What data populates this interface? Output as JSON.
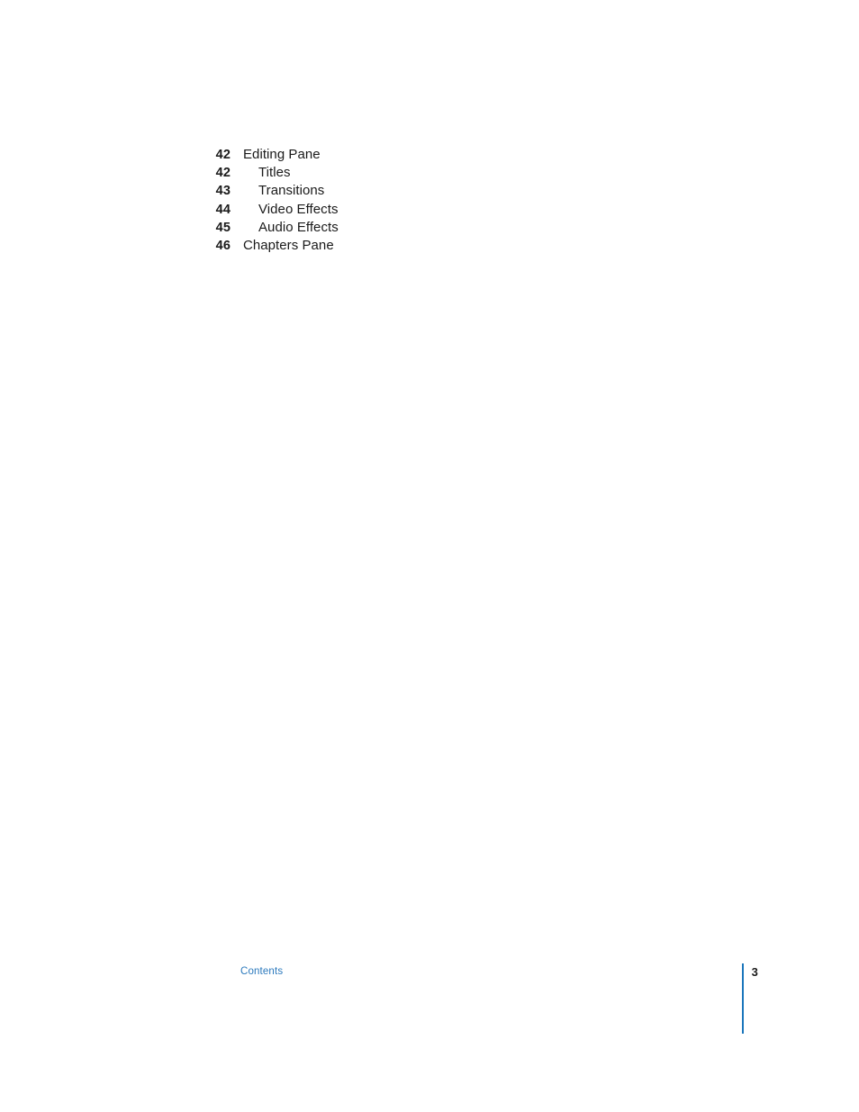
{
  "document": {
    "section_name": "Contents",
    "page_number": "3"
  },
  "colors": {
    "page_background": "#ffffff",
    "text": "#1a1a1a",
    "accent_blue": "#1b76bc",
    "footer_link_blue": "#2b79bd"
  },
  "toc": {
    "entries": [
      {
        "page": "42",
        "label": "Editing Pane",
        "level": 1
      },
      {
        "page": "42",
        "label": "Titles",
        "level": 2
      },
      {
        "page": "43",
        "label": "Transitions",
        "level": 2
      },
      {
        "page": "44",
        "label": "Video Effects",
        "level": 2
      },
      {
        "page": "45",
        "label": "Audio Effects",
        "level": 2
      },
      {
        "page": "46",
        "label": "Chapters Pane",
        "level": 1
      }
    ]
  },
  "footer": {
    "section_label": "Contents",
    "folio": "3"
  }
}
